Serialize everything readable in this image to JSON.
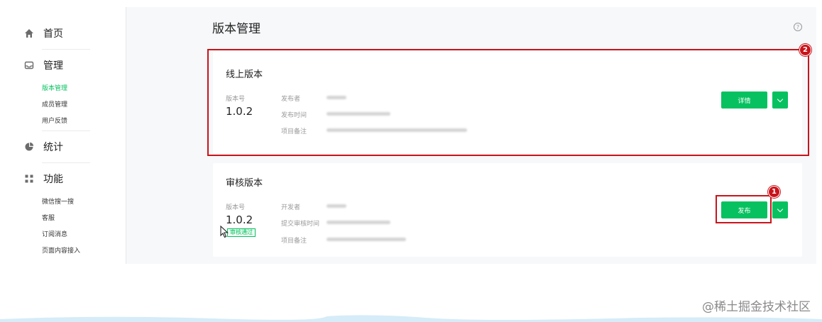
{
  "sidebar": {
    "home": "首页",
    "manage": {
      "label": "管理",
      "items": [
        "版本管理",
        "成员管理",
        "用户反馈"
      ]
    },
    "stats": "统计",
    "features": {
      "label": "功能",
      "items": [
        "微信搜一搜",
        "客服",
        "订阅消息",
        "页面内容接入"
      ]
    }
  },
  "page": {
    "title": "版本管理",
    "help": "?"
  },
  "online": {
    "title": "线上版本",
    "version_label": "版本号",
    "version": "1.0.2",
    "publisher_label": "发布者",
    "time_label": "发布时间",
    "note_label": "项目备注",
    "detail_button": "详情",
    "annotation": "2"
  },
  "review": {
    "title": "审核版本",
    "version_label": "版本号",
    "version": "1.0.2",
    "status": "审核通过",
    "developer_label": "开发者",
    "submit_time_label": "提交审核时间",
    "note_label": "项目备注",
    "publish_button": "发布",
    "annotation": "1"
  },
  "watermark": "@稀土掘金技术社区",
  "colors": {
    "accent": "#07c160",
    "annotation": "#c9141b"
  }
}
